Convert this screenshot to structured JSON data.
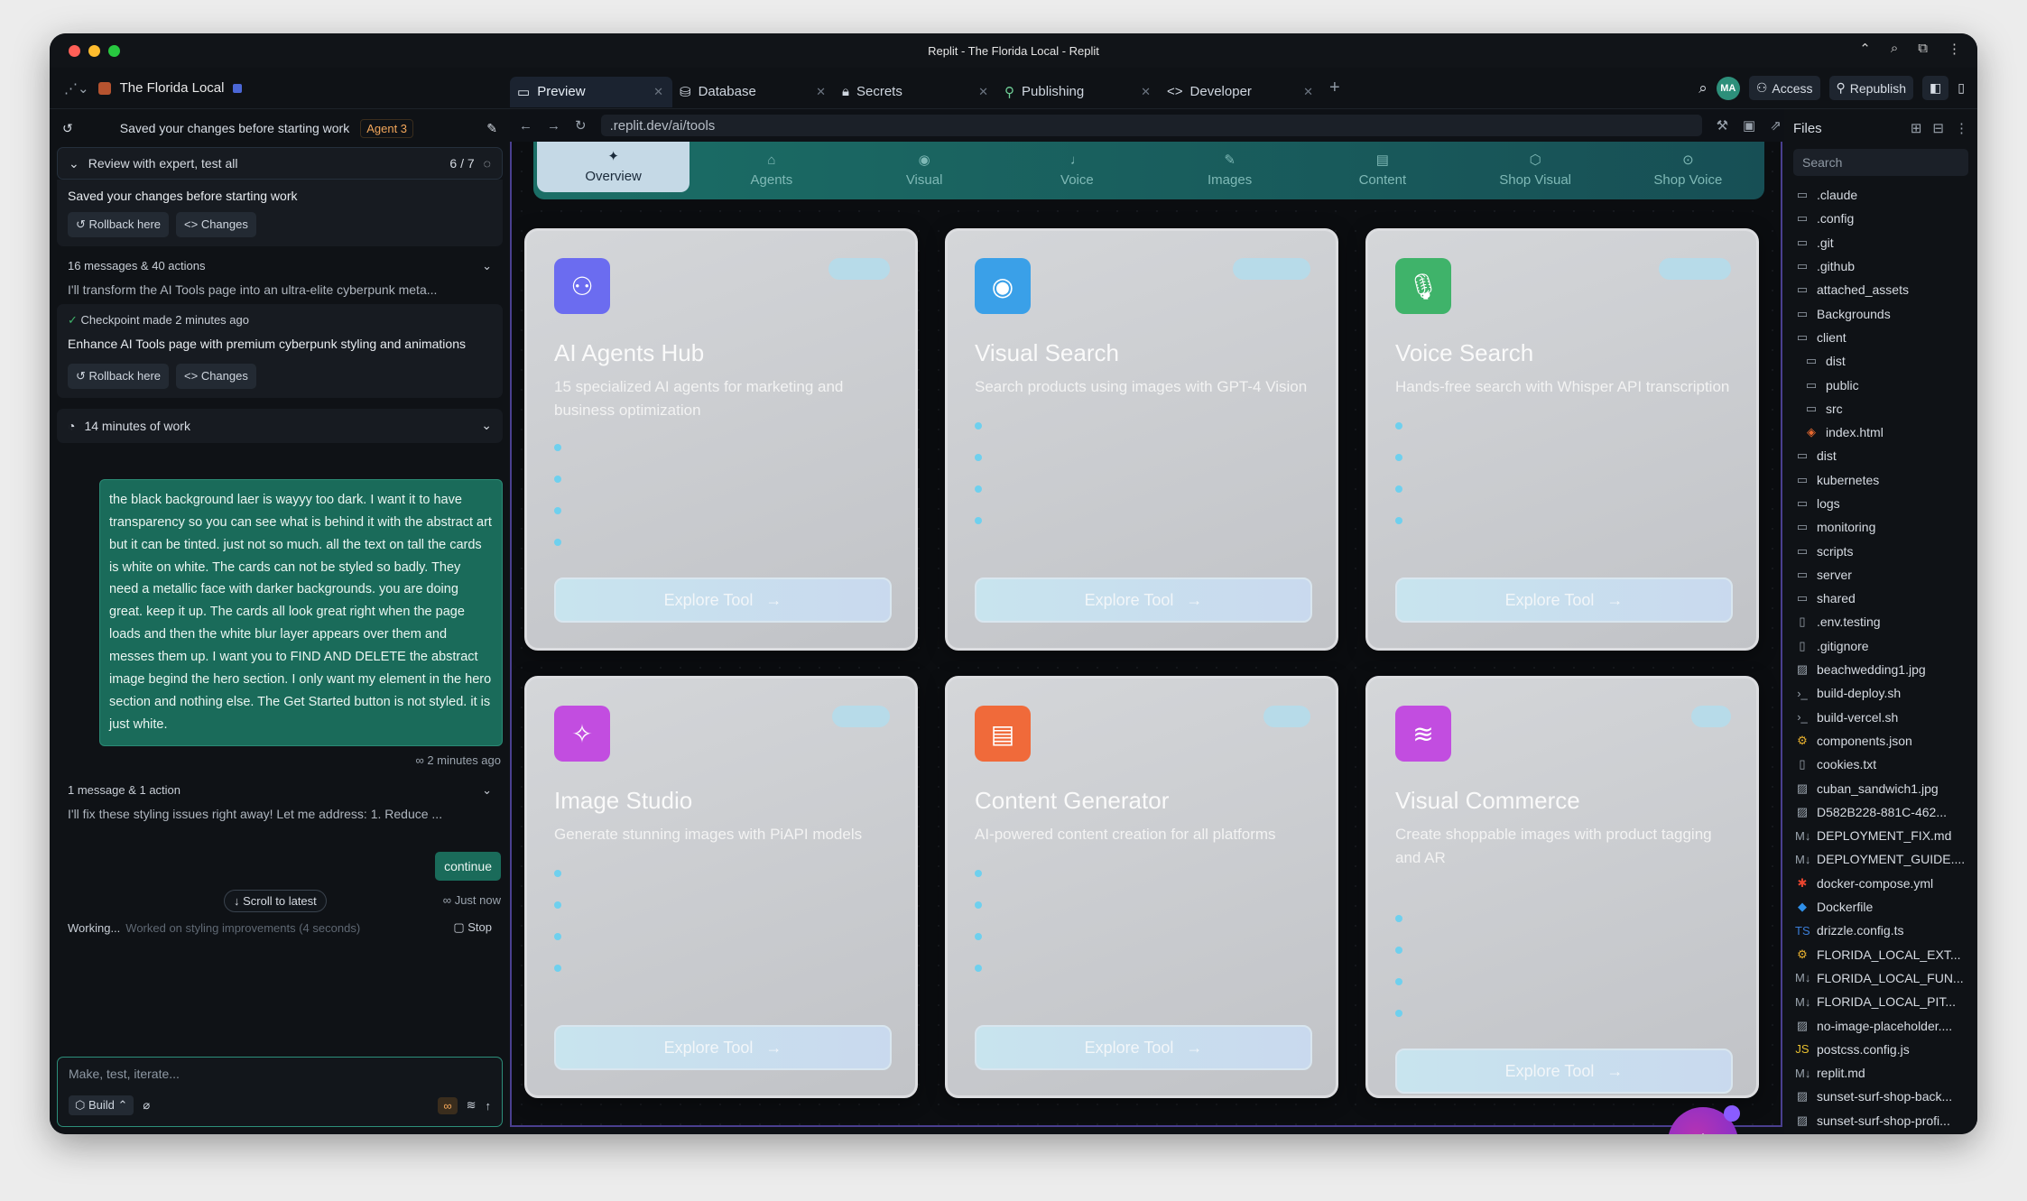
{
  "window": {
    "title": "Replit - The Florida Local - Replit"
  },
  "topbar": {
    "project_name": "The Florida Local",
    "tabs": [
      {
        "label": "Preview",
        "icon": "monitor-icon"
      },
      {
        "label": "Database",
        "icon": "database-icon"
      },
      {
        "label": "Secrets",
        "icon": "lock-icon"
      },
      {
        "label": "Publishing",
        "icon": "rocket-icon"
      },
      {
        "label": "Developer",
        "icon": "code-icon"
      }
    ],
    "avatar_initials": "MA",
    "access_label": "Access",
    "republish_label": "Republish"
  },
  "chat": {
    "header_text": "Saved your changes before starting work",
    "agent_badge": "Agent 3",
    "review_label": "Review with expert, test all",
    "review_count": "6 / 7",
    "saved_text": "Saved your changes before starting work",
    "rollback_label": "Rollback here",
    "changes_label": "Changes",
    "summary1_title": "16 messages & 40 actions",
    "summary1_text": "I'll transform the AI Tools page into an ultra-elite cyberpunk meta...",
    "checkpoint_title": "Checkpoint made 2 minutes ago",
    "checkpoint_text": "Enhance AI Tools page with premium cyberpunk styling and animations",
    "work_label": "14 minutes of work",
    "user_message": "the black background laer is wayyy too dark. I want it to have transparency so you can see what is behind it with the abstract art but it can be tinted. just not so much. all the text on tall the cards is white on white. The cards can not be styled so badly. They need a metallic face with darker backgrounds. you are doing great. keep it up. The cards all look great right when the page loads and then the white blur layer appears over them and messes them up. I want you to FIND AND DELETE the abstract image begind the hero section. I only want my element in the hero section and nothing else. The Get Started button is not styled. it is just white.",
    "user_message_time": "2 minutes ago",
    "summary2_title": "1 message & 1 action",
    "summary2_text": "I'll fix these styling issues right away! Let me address: 1. Reduce ...",
    "continue_label": "continue",
    "continue_time": "Just now",
    "scroll_label": "Scroll to latest",
    "working_label": "Working...",
    "working_detail": "Worked on styling improvements (4 seconds)",
    "stop_label": "Stop",
    "input_placeholder": "Make, test, iterate...",
    "build_label": "Build"
  },
  "browser": {
    "url": ".replit.dev/ai/tools",
    "nav": [
      "Overview",
      "Agents",
      "Visual",
      "Voice",
      "Images",
      "Content",
      "Shop Visual",
      "Shop Voice"
    ],
    "active_nav": "Overview"
  },
  "cards": [
    {
      "title": "AI Agents Hub",
      "desc": "15 specialized AI agents for marketing and business optimization",
      "color": "#6b6cf0",
      "icon": "robot-icon",
      "dots": 4,
      "button": "Explore Tool"
    },
    {
      "title": "Visual Search",
      "desc": "Search products using images with GPT-4 Vision",
      "color": "#3aa0e8",
      "icon": "eye-icon",
      "dots": 4,
      "button": "Explore Tool"
    },
    {
      "title": "Voice Search",
      "desc": "Hands-free search with Whisper API transcription",
      "color": "#3fb36a",
      "icon": "microphone-icon",
      "dots": 4,
      "button": "Explore Tool"
    },
    {
      "title": "Image Studio",
      "desc": "Generate stunning images with PiAPI models",
      "color": "#c24de0",
      "icon": "magic-wand-icon",
      "dots": 4,
      "button": "Explore Tool"
    },
    {
      "title": "Content Generator",
      "desc": "AI-powered content creation for all platforms",
      "color": "#f06a3a",
      "icon": "document-icon",
      "dots": 4,
      "button": "Explore Tool"
    },
    {
      "title": "Visual Commerce",
      "desc": "Create shoppable images with product tagging and AR",
      "color": "#c24de0",
      "icon": "layers-icon",
      "dots": 4,
      "button": "Explore Tool"
    }
  ],
  "files": {
    "title": "Files",
    "search_placeholder": "Search",
    "items": [
      {
        "name": ".claude",
        "type": "folder"
      },
      {
        "name": ".config",
        "type": "folder"
      },
      {
        "name": ".git",
        "type": "folder"
      },
      {
        "name": ".github",
        "type": "folder"
      },
      {
        "name": "attached_assets",
        "type": "folder"
      },
      {
        "name": "Backgrounds",
        "type": "folder"
      },
      {
        "name": "client",
        "type": "folder"
      },
      {
        "name": "dist",
        "type": "folder",
        "indent": 1
      },
      {
        "name": "public",
        "type": "folder",
        "indent": 1
      },
      {
        "name": "src",
        "type": "folder",
        "indent": 1
      },
      {
        "name": "index.html",
        "type": "html",
        "indent": 1
      },
      {
        "name": "dist",
        "type": "folder"
      },
      {
        "name": "kubernetes",
        "type": "folder"
      },
      {
        "name": "logs",
        "type": "folder"
      },
      {
        "name": "monitoring",
        "type": "folder"
      },
      {
        "name": "scripts",
        "type": "folder"
      },
      {
        "name": "server",
        "type": "folder"
      },
      {
        "name": "shared",
        "type": "folder"
      },
      {
        "name": ".env.testing",
        "type": "file"
      },
      {
        "name": ".gitignore",
        "type": "file"
      },
      {
        "name": "beachwedding1.jpg",
        "type": "image"
      },
      {
        "name": "build-deploy.sh",
        "type": "shell"
      },
      {
        "name": "build-vercel.sh",
        "type": "shell"
      },
      {
        "name": "components.json",
        "type": "json"
      },
      {
        "name": "cookies.txt",
        "type": "file"
      },
      {
        "name": "cuban_sandwich1.jpg",
        "type": "image"
      },
      {
        "name": "D582B228-881C-462...",
        "type": "image"
      },
      {
        "name": "DEPLOYMENT_FIX.md",
        "type": "md"
      },
      {
        "name": "DEPLOYMENT_GUIDE....",
        "type": "md"
      },
      {
        "name": "docker-compose.yml",
        "type": "yml"
      },
      {
        "name": "Dockerfile",
        "type": "docker"
      },
      {
        "name": "drizzle.config.ts",
        "type": "ts"
      },
      {
        "name": "FLORIDA_LOCAL_EXT...",
        "type": "json"
      },
      {
        "name": "FLORIDA_LOCAL_FUN...",
        "type": "md"
      },
      {
        "name": "FLORIDA_LOCAL_PIT...",
        "type": "md"
      },
      {
        "name": "no-image-placeholder....",
        "type": "image"
      },
      {
        "name": "postcss.config.js",
        "type": "js"
      },
      {
        "name": "replit.md",
        "type": "md"
      },
      {
        "name": "sunset-surf-shop-back...",
        "type": "image"
      },
      {
        "name": "sunset-surf-shop-profi...",
        "type": "image"
      }
    ]
  },
  "colors": {
    "accent": "#1a6b5a",
    "preview_border": "#4a3f8f",
    "nav_gradient": "#1b6e66"
  }
}
